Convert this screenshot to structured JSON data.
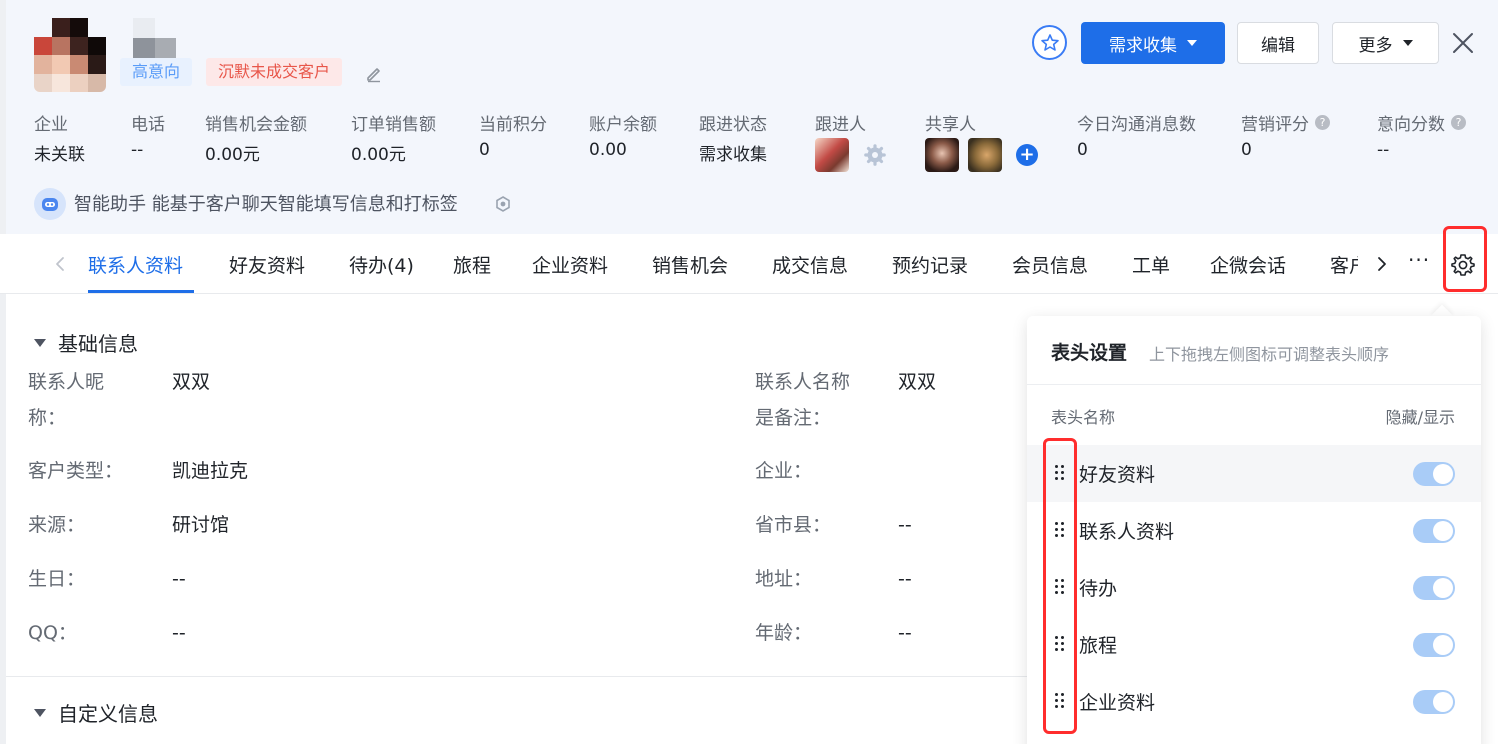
{
  "customer": {
    "tag_intent": "高意向",
    "tag_status": "沉默未成交客户"
  },
  "actions": {
    "collect_label": "需求收集",
    "edit_label": "编辑",
    "more_label": "更多"
  },
  "stats": [
    {
      "label": "企业",
      "value": "未关联"
    },
    {
      "label": "电话",
      "value": "--"
    },
    {
      "label": "销售机会金额",
      "value": "0.00元"
    },
    {
      "label": "订单销售额",
      "value": "0.00元"
    },
    {
      "label": "当前积分",
      "value": "0"
    },
    {
      "label": "账户余额",
      "value": "0.00"
    },
    {
      "label": "跟进状态",
      "value": "需求收集"
    },
    {
      "label": "跟进人",
      "value": ""
    },
    {
      "label": "共享人",
      "value": ""
    },
    {
      "label": "今日沟通消息数",
      "value": "0"
    },
    {
      "label": "营销评分",
      "value": "0"
    },
    {
      "label": "意向分数",
      "value": "--"
    }
  ],
  "assistant": {
    "text": "智能助手 能基于客户聊天智能填写信息和打标签"
  },
  "tabs": [
    {
      "label": "联系人资料"
    },
    {
      "label": "好友资料"
    },
    {
      "label": "待办(4)"
    },
    {
      "label": "旅程"
    },
    {
      "label": "企业资料"
    },
    {
      "label": "销售机会"
    },
    {
      "label": "成交信息"
    },
    {
      "label": "预约记录"
    },
    {
      "label": "会员信息"
    },
    {
      "label": "工单"
    },
    {
      "label": "企微会话"
    },
    {
      "label": "客户"
    }
  ],
  "tab_more": "···",
  "basic": {
    "title": "基础信息",
    "fields_left": [
      {
        "label": "联系人昵",
        "label2": "称：",
        "value": "双双"
      },
      {
        "label": "客户类型：",
        "value": "凯迪拉克"
      },
      {
        "label": "来源：",
        "value": "研讨馆"
      },
      {
        "label": "生日：",
        "value": "--"
      },
      {
        "label": "QQ：",
        "value": "--"
      }
    ],
    "fields_right": [
      {
        "label": "联系人名称",
        "label2": "是备注：",
        "value": "双双"
      },
      {
        "label": "企业：",
        "value": ""
      },
      {
        "label": "省市县：",
        "value": "--"
      },
      {
        "label": "地址：",
        "value": "--"
      },
      {
        "label": "年龄：",
        "value": "--"
      }
    ]
  },
  "custom": {
    "title": "自定义信息"
  },
  "popover": {
    "title": "表头设置",
    "hint": "上下拖拽左侧图标可调整表头顺序",
    "col_name": "表头名称",
    "col_toggle": "隐藏/显示",
    "rows": [
      {
        "label": "好友资料",
        "visible": true
      },
      {
        "label": "联系人资料",
        "visible": true
      },
      {
        "label": "待办",
        "visible": true
      },
      {
        "label": "旅程",
        "visible": true
      },
      {
        "label": "企业资料",
        "visible": true
      }
    ]
  },
  "colors": {
    "primary": "#1e6ee8",
    "highlight_box": "#ff2d2d",
    "tag_red": "#e8564a",
    "tag_blue": "#5a9cf8"
  }
}
